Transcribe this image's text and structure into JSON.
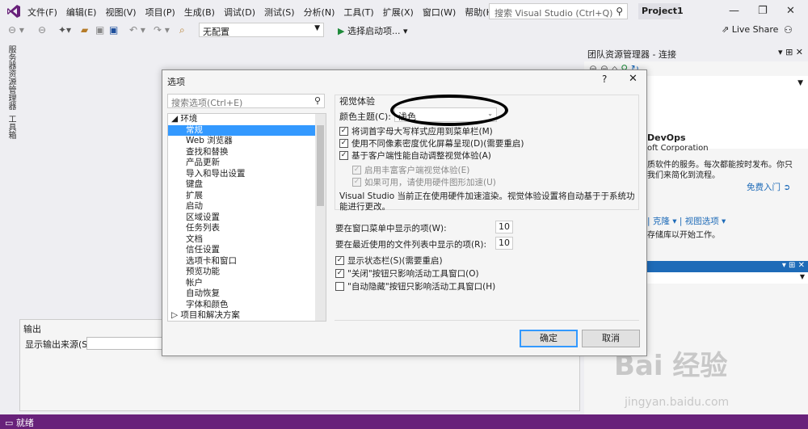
{
  "menu": [
    "文件(F)",
    "编辑(E)",
    "视图(V)",
    "项目(P)",
    "生成(B)",
    "调试(D)",
    "测试(S)",
    "分析(N)",
    "工具(T)",
    "扩展(X)",
    "窗口(W)",
    "帮助(H)"
  ],
  "search": {
    "placeholder": "搜索 Visual Studio (Ctrl+Q)"
  },
  "project_name": "Project1",
  "toolbar": {
    "config": "无配置",
    "start": "选择启动项...",
    "live_share": "Live Share"
  },
  "left_strip": {
    "server_explorer": "服务器资源管理器",
    "toolbox": "工具箱"
  },
  "team_explorer": {
    "title": "团队资源管理器 - 连接",
    "devops_title": "DevOps",
    "devops_org": "oft Corporation",
    "desc": "质软件的服务。每次都能按时发布。你只",
    "desc2": "我们来简化到流程。",
    "get_started": "免费入门",
    "clone": "克隆",
    "view_options": "视图选项",
    "repo_text": "存储库以开始工作。"
  },
  "output": {
    "title": "输出",
    "source_label": "显示输出来源(S):"
  },
  "status": "就绪",
  "dialog": {
    "title": "选项",
    "help": "?",
    "search_placeholder": "搜索选项(Ctrl+E)",
    "tree": [
      {
        "label": "◢ 环境",
        "indent": 0,
        "selected": false
      },
      {
        "label": "常规",
        "indent": 1,
        "selected": true
      },
      {
        "label": "Web 浏览器",
        "indent": 1,
        "selected": false
      },
      {
        "label": "查找和替换",
        "indent": 1,
        "selected": false
      },
      {
        "label": "产品更新",
        "indent": 1,
        "selected": false
      },
      {
        "label": "导入和导出设置",
        "indent": 1,
        "selected": false
      },
      {
        "label": "键盘",
        "indent": 1,
        "selected": false
      },
      {
        "label": "扩展",
        "indent": 1,
        "selected": false
      },
      {
        "label": "启动",
        "indent": 1,
        "selected": false
      },
      {
        "label": "区域设置",
        "indent": 1,
        "selected": false
      },
      {
        "label": "任务列表",
        "indent": 1,
        "selected": false
      },
      {
        "label": "文档",
        "indent": 1,
        "selected": false
      },
      {
        "label": "信任设置",
        "indent": 1,
        "selected": false
      },
      {
        "label": "选项卡和窗口",
        "indent": 1,
        "selected": false
      },
      {
        "label": "预览功能",
        "indent": 1,
        "selected": false
      },
      {
        "label": "帐户",
        "indent": 1,
        "selected": false
      },
      {
        "label": "自动恢复",
        "indent": 1,
        "selected": false
      },
      {
        "label": "字体和颜色",
        "indent": 1,
        "selected": false
      },
      {
        "label": "▷ 项目和解决方案",
        "indent": 0,
        "selected": false
      }
    ],
    "visual_group_title": "视觉体验",
    "theme_label": "颜色主题(C):",
    "theme_value": "浅色",
    "checks": [
      {
        "label": "将词首字母大写样式应用到菜单栏(M)",
        "checked": true,
        "disabled": false
      },
      {
        "label": "使用不同像素密度优化屏幕呈现(D)(需要重启)",
        "checked": true,
        "disabled": false
      },
      {
        "label": "基于客户端性能自动调整视觉体验(A)",
        "checked": true,
        "disabled": false
      },
      {
        "label": "启用丰富客户端视觉体验(E)",
        "checked": true,
        "disabled": true
      },
      {
        "label": "如果可用，请使用硬件图形加速(U)",
        "checked": true,
        "disabled": true
      }
    ],
    "accel_info": "Visual Studio 当前正在使用硬件加速渲染。视觉体验设置将自动基于于系统功能进行更改。",
    "window_menu_label": "要在窗口菜单中显示的项(W):",
    "window_menu_value": "10",
    "recent_files_label": "要在最近使用的文件列表中显示的项(R):",
    "recent_files_value": "10",
    "checks2": [
      {
        "label": "显示状态栏(S)(需要重启)",
        "checked": true
      },
      {
        "label": "\"关闭\"按钮只影响活动工具窗口(O)",
        "checked": true
      },
      {
        "label": "\"自动隐藏\"按钮只影响活动工具窗口(H)",
        "checked": false
      }
    ],
    "ok": "确定",
    "cancel": "取消"
  },
  "watermark": {
    "brand": "Bai 经验",
    "url": "jingyan.baidu.com"
  },
  "colors": {
    "status_bar": "#68217a",
    "selection": "#3399ff",
    "accent": "#1e6bb8"
  }
}
